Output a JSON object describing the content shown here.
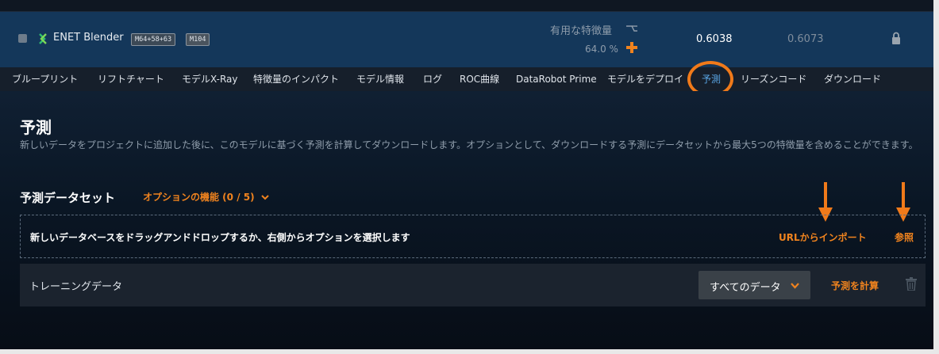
{
  "model": {
    "name": "ENET Blender",
    "blueprint_badge": "M64+58+63",
    "model_badge": "M104",
    "feature_label": "有用な特徴量",
    "feature_pct": "64.0 %",
    "score_main": "0.6038",
    "score_sub": "0.6073"
  },
  "tabs": [
    {
      "label": "ブループリント"
    },
    {
      "label": "リフトチャート"
    },
    {
      "label": "モデルX-Ray"
    },
    {
      "label": "特徴量のインパクト"
    },
    {
      "label": "モデル情報"
    },
    {
      "label": "ログ"
    },
    {
      "label": "ROC曲線"
    },
    {
      "label": "DataRobot Prime"
    },
    {
      "label": "モデルをデプロイ"
    },
    {
      "label": "予測",
      "active": true
    },
    {
      "label": "リーズンコード"
    },
    {
      "label": "ダウンロード"
    }
  ],
  "page": {
    "title": "予測",
    "description": "新しいデータをプロジェクトに追加した後に、このモデルに基づく予測を計算してダウンロードします。オプションとして、ダウンロードする予測にデータセットから最大5つの特徴量を含めることができます。"
  },
  "datasets": {
    "title": "予測データセット",
    "options_label": "オプションの機能 (0 / 5)",
    "drop_text": "新しいデータベースをドラッグアンドドロップするか、右側からオプションを選択します",
    "url_import": "URLからインポート",
    "browse": "参照",
    "rows": [
      {
        "name": "トレーニングデータ",
        "selected": "すべてのデータ",
        "action": "予測を計算"
      }
    ]
  },
  "colors": {
    "accent_orange": "#f0831e",
    "active_tab_blue": "#5aa7e6",
    "model_row_bg": "#14375a",
    "annotation_orange": "#f07a1a"
  },
  "icons": {
    "checkbox": "checkbox-icon",
    "blender": "blender-icon",
    "feature": "feature-icon",
    "plus": "plus-icon",
    "lock": "lock-icon",
    "chevron": "chevron-down-icon",
    "trash": "trash-icon",
    "arrow": "arrow-down-icon"
  }
}
